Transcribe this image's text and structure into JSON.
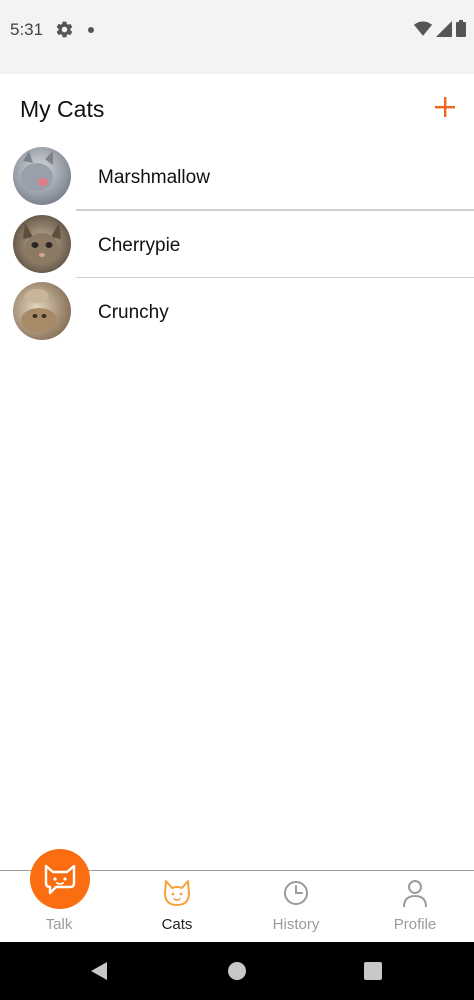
{
  "status_bar": {
    "time": "5:31",
    "icons": [
      "gear-icon",
      "notification-dot-icon",
      "wifi-icon",
      "signal-icon",
      "battery-icon"
    ]
  },
  "header": {
    "title": "My Cats",
    "add_icon": "plus-icon",
    "accent_color": "#f0641c"
  },
  "cats": [
    {
      "name": "Marshmallow",
      "avatar_colors": [
        "#8a8f9a",
        "#d9dde3"
      ]
    },
    {
      "name": "Cherrypie",
      "avatar_colors": [
        "#6b5a48",
        "#c9b9a1"
      ]
    },
    {
      "name": "Crunchy",
      "avatar_colors": [
        "#a88b66",
        "#e4d6bf"
      ]
    }
  ],
  "tabs": [
    {
      "label": "Talk",
      "icon": "cat-chat-icon",
      "active": false
    },
    {
      "label": "Cats",
      "icon": "cat-icon",
      "active": true
    },
    {
      "label": "History",
      "icon": "clock-icon",
      "active": false
    },
    {
      "label": "Profile",
      "icon": "person-icon",
      "active": false
    }
  ],
  "colors": {
    "accent": "#fb6d11",
    "active_tab": "#222222",
    "inactive_tab": "#9b9b9b",
    "divider": "#cfcfcf"
  },
  "system_nav": {
    "icons": [
      "back-icon",
      "home-icon",
      "recents-icon"
    ]
  }
}
